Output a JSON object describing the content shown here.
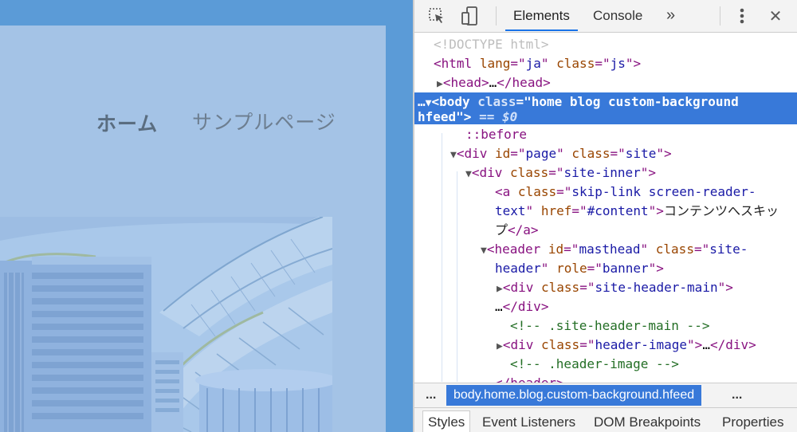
{
  "preview": {
    "nav": {
      "home": "ホーム",
      "sample": "サンプルページ"
    }
  },
  "devtools": {
    "toolbar": {
      "inspect_icon": "cursor-select-icon",
      "device_icon": "device-toggle-icon",
      "tabs": [
        {
          "label": "Elements",
          "active": true
        },
        {
          "label": "Console",
          "active": false
        }
      ],
      "more": "»",
      "menu_icon": "kebab-menu-icon",
      "close": "✕"
    },
    "tree": {
      "doctype": "<!DOCTYPE html>",
      "html": {
        "tag": "html",
        "attr1": "lang",
        "val1": "ja",
        "attr2": "class",
        "val2": "js"
      },
      "head": {
        "tag": "head"
      },
      "body": {
        "tag": "body",
        "attr": "class",
        "val_line1": "home blog custom-background",
        "val_line2": "hfeed",
        "eq": "== $0"
      },
      "before": "::before",
      "page_div": {
        "tag": "div",
        "attr1": "id",
        "val1": "page",
        "attr2": "class",
        "val2": "site"
      },
      "inner_div": {
        "tag": "div",
        "attr": "class",
        "val": "site-inner"
      },
      "skip_link": {
        "tag": "a",
        "attr1": "class",
        "val1_a": "skip-link screen-reader-",
        "val1_b": "text",
        "attr2": "href",
        "val2": "#content",
        "text_a": "コンテンツへスキッ",
        "text_b": "プ"
      },
      "header": {
        "tag": "header",
        "attr1": "id",
        "val1": "masthead",
        "attr2": "class",
        "val2_a": "site-",
        "val2_b": "header",
        "attr3": "role",
        "val3": "banner"
      },
      "header_main": {
        "tag": "div",
        "attr": "class",
        "val": "site-header-main"
      },
      "comment1": "<!-- .site-header-main -->",
      "header_image": {
        "tag": "div",
        "attr": "class",
        "val": "header-image"
      },
      "comment2": "<!-- .header-image -->",
      "header_close": "header"
    },
    "breadcrumb": {
      "left": "...",
      "crumb": "body.home.blog.custom-background.hfeed",
      "right": "..."
    },
    "subtabs": [
      "Styles",
      "Event Listeners",
      "DOM Breakpoints",
      "Properties"
    ]
  }
}
